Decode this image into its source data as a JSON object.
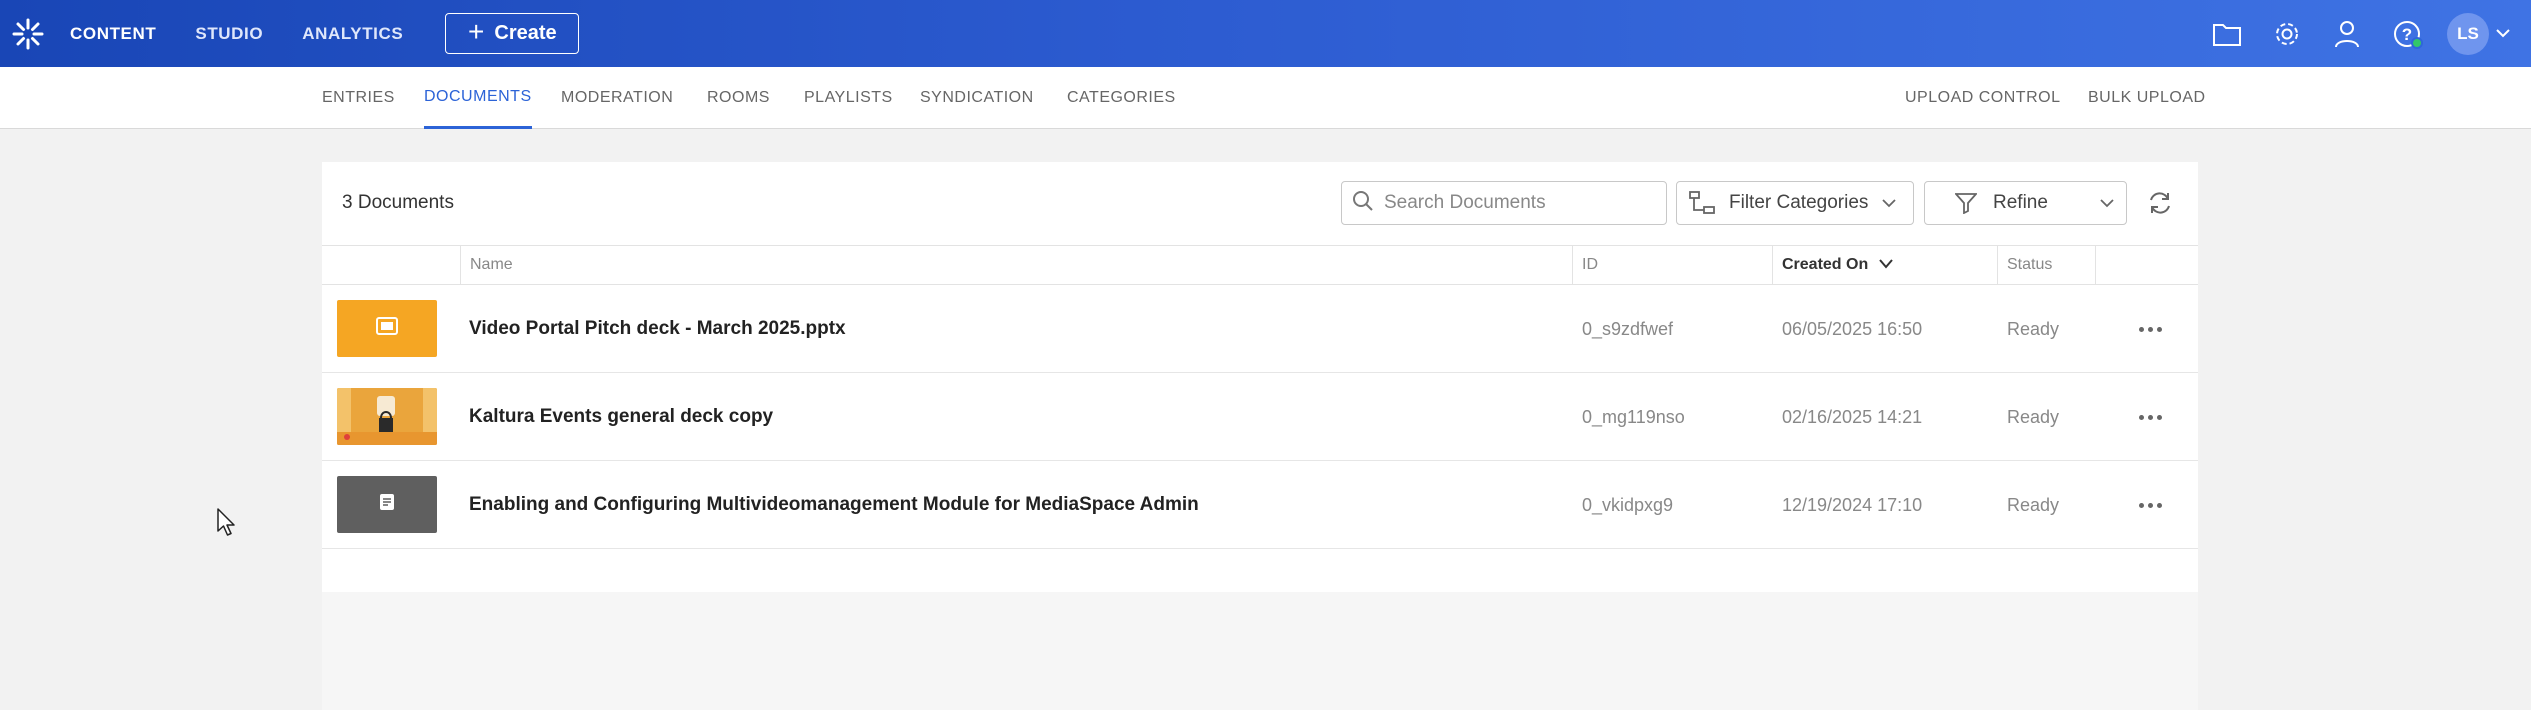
{
  "topbar": {
    "nav": [
      {
        "label": "CONTENT",
        "active": true
      },
      {
        "label": "STUDIO",
        "active": false
      },
      {
        "label": "ANALYTICS",
        "active": false
      }
    ],
    "create_label": "Create",
    "user_initials": "LS",
    "icons": [
      "folder-icon",
      "gear-icon",
      "user-icon",
      "help-icon",
      "chevron-down-icon"
    ]
  },
  "subnav": {
    "tabs": [
      {
        "label": "ENTRIES"
      },
      {
        "label": "DOCUMENTS",
        "active": true
      },
      {
        "label": "MODERATION"
      },
      {
        "label": "ROOMS"
      },
      {
        "label": "PLAYLISTS"
      },
      {
        "label": "SYNDICATION"
      },
      {
        "label": "CATEGORIES"
      }
    ],
    "right": [
      {
        "label": "UPLOAD CONTROL"
      },
      {
        "label": "BULK UPLOAD"
      }
    ]
  },
  "toolbar": {
    "count_label": "3 Documents",
    "search_placeholder": "Search Documents",
    "filter_categories_label": "Filter Categories",
    "refine_label": "Refine"
  },
  "table": {
    "columns": {
      "name": "Name",
      "id": "ID",
      "created_on": "Created On",
      "status": "Status"
    },
    "sorted_by": "Created On",
    "rows": [
      {
        "name": "Video Portal Pitch deck - March 2025.pptx",
        "id": "0_s9zdfwef",
        "created_on": "06/05/2025 16:50",
        "status": "Ready",
        "thumb_color": "#f5a623",
        "thumb_icon": "presentation-icon"
      },
      {
        "name": "Kaltura Events general deck copy",
        "id": "0_mg119nso",
        "created_on": "02/16/2025 14:21",
        "status": "Ready",
        "thumb_color": "#e8a83b",
        "thumb_icon": "image-thumbnail"
      },
      {
        "name": "Enabling and Configuring Multivideomanagement Module for MediaSpace Admin",
        "id": "0_vkidpxg9",
        "created_on": "12/19/2024 17:10",
        "status": "Ready",
        "thumb_color": "#5f5f5f",
        "thumb_icon": "document-icon"
      }
    ]
  },
  "colors": {
    "accent": "#2c63d7",
    "topbar_start": "#1946b6",
    "topbar_end": "#3f73e4"
  }
}
